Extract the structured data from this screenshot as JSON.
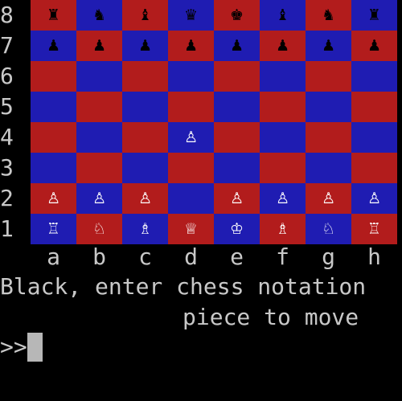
{
  "colors": {
    "background": "#000000",
    "text": "#c8c8c8",
    "light_square": "#b21c1c",
    "dark_square": "#1f1cb2",
    "white_piece": "#ffffff",
    "black_piece": "#000000",
    "cursor": "#b7b7b7"
  },
  "board": {
    "ranks": [
      "8",
      "7",
      "6",
      "5",
      "4",
      "3",
      "2",
      "1"
    ],
    "files": [
      "a",
      "b",
      "c",
      "d",
      "e",
      "f",
      "g",
      "h"
    ],
    "rows": [
      [
        "♜",
        "♞",
        "♝",
        "♛",
        "♚",
        "♝",
        "♞",
        "♜"
      ],
      [
        "♟",
        "♟",
        "♟",
        "♟",
        "♟",
        "♟",
        "♟",
        "♟"
      ],
      [
        "",
        "",
        "",
        "",
        "",
        "",
        "",
        ""
      ],
      [
        "",
        "",
        "",
        "",
        "",
        "",
        "",
        ""
      ],
      [
        "",
        "",
        "",
        "♙",
        "",
        "",
        "",
        ""
      ],
      [
        "",
        "",
        "",
        "",
        "",
        "",
        "",
        ""
      ],
      [
        "♙",
        "♙",
        "♙",
        "",
        "♙",
        "♙",
        "♙",
        "♙"
      ],
      [
        "♖",
        "♘",
        "♗",
        "♕",
        "♔",
        "♗",
        "♘",
        "♖"
      ]
    ]
  },
  "prompt": {
    "line1": "Black, enter chess notation",
    "line2": "piece to move",
    "input_symbol": ">>"
  }
}
